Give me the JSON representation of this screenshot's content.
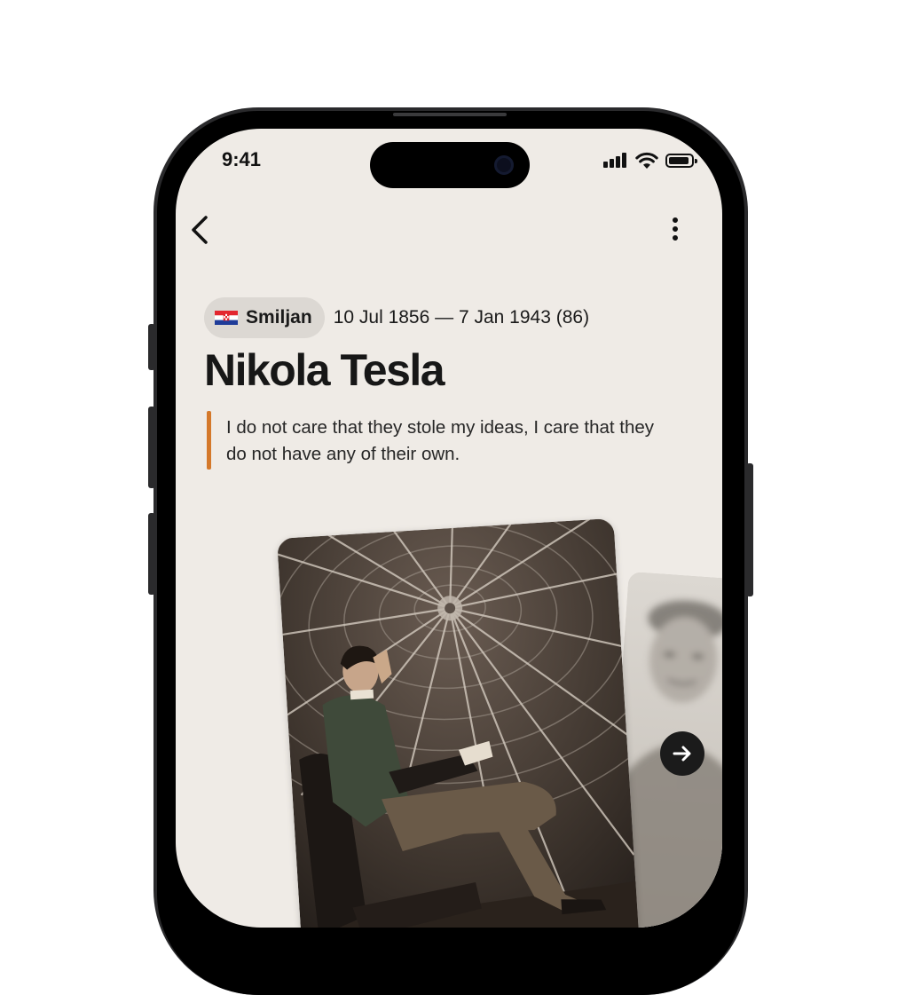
{
  "status_bar": {
    "time": "9:41"
  },
  "nav": {
    "back_icon": "chevron-left-icon",
    "more_icon": "more-vertical-icon"
  },
  "person": {
    "birthplace": "Smiljan",
    "flag": "croatia-flag-icon",
    "dates": "10 Jul 1856 — 7 Jan 1943 (86)",
    "name": "Nikola Tesla",
    "quote": "I do not care that they stole my ideas, I care that they do not have any of their own."
  },
  "carousel": {
    "next_icon": "arrow-right-icon"
  },
  "colors": {
    "screen_bg": "#efebe6",
    "chip_bg": "#dcd8d3",
    "quote_accent": "#d4782a",
    "text": "#171717"
  }
}
